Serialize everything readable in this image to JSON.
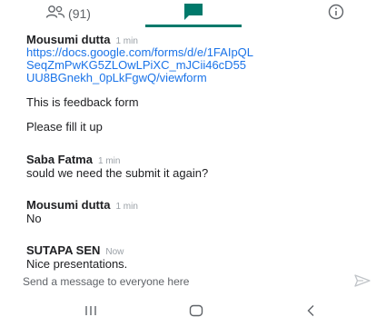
{
  "tabs": {
    "people_count": "(91)",
    "active": "chat",
    "accent_color": "#00796b"
  },
  "messages": [
    {
      "sender": "Mousumi dutta",
      "time": "1 min",
      "link": "https://docs.google.com/forms/d/e/1FAIpQLSeqZmPwKG5ZLOwLPiXC_mJCii46cD55UU8BGnekh_0pLkFgwQ/viewform",
      "lines": [
        "This is feedback form",
        "Please fill it up"
      ]
    },
    {
      "sender": "Saba Fatma",
      "time": "1 min",
      "lines": [
        "sould we need the submit it again?"
      ]
    },
    {
      "sender": "Mousumi dutta",
      "time": "1 min",
      "lines": [
        "No"
      ]
    },
    {
      "sender": "SUTAPA SEN",
      "time": "Now",
      "lines": [
        "Nice presentations."
      ]
    }
  ],
  "compose": {
    "placeholder": "Send a message to everyone here",
    "value": ""
  },
  "icons": {
    "people": "people-icon",
    "chat": "chat-icon",
    "info": "info-icon",
    "send": "send-icon",
    "recents": "recents-icon",
    "home": "home-icon",
    "back": "back-icon"
  }
}
